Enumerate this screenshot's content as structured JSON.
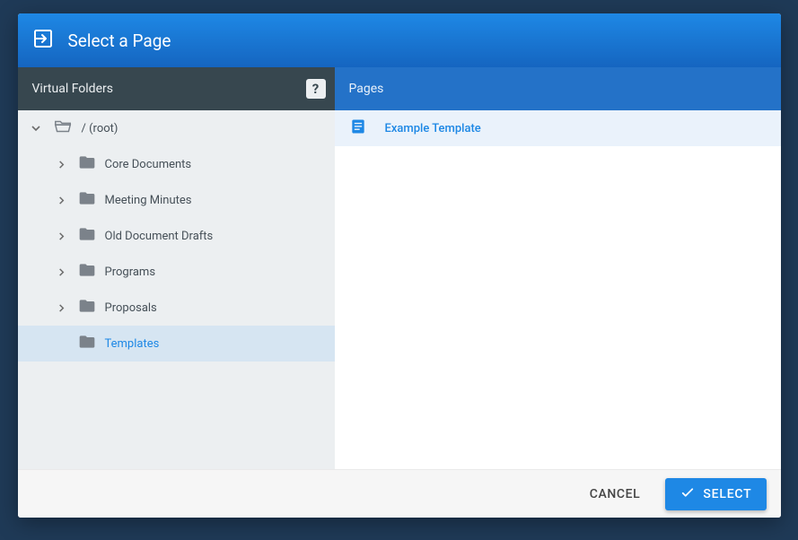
{
  "dialog": {
    "title": "Select a Page"
  },
  "leftHeader": {
    "title": "Virtual Folders",
    "helpGlyph": "?"
  },
  "rightHeader": {
    "title": "Pages"
  },
  "tree": {
    "root": {
      "label": "/ (root)"
    },
    "items": [
      {
        "label": "Core Documents"
      },
      {
        "label": "Meeting Minutes"
      },
      {
        "label": "Old Document Drafts"
      },
      {
        "label": "Programs"
      },
      {
        "label": "Proposals"
      },
      {
        "label": "Templates"
      }
    ]
  },
  "pages": {
    "items": [
      {
        "label": "Example Template"
      }
    ]
  },
  "footer": {
    "cancel": "CANCEL",
    "select": "SELECT"
  }
}
